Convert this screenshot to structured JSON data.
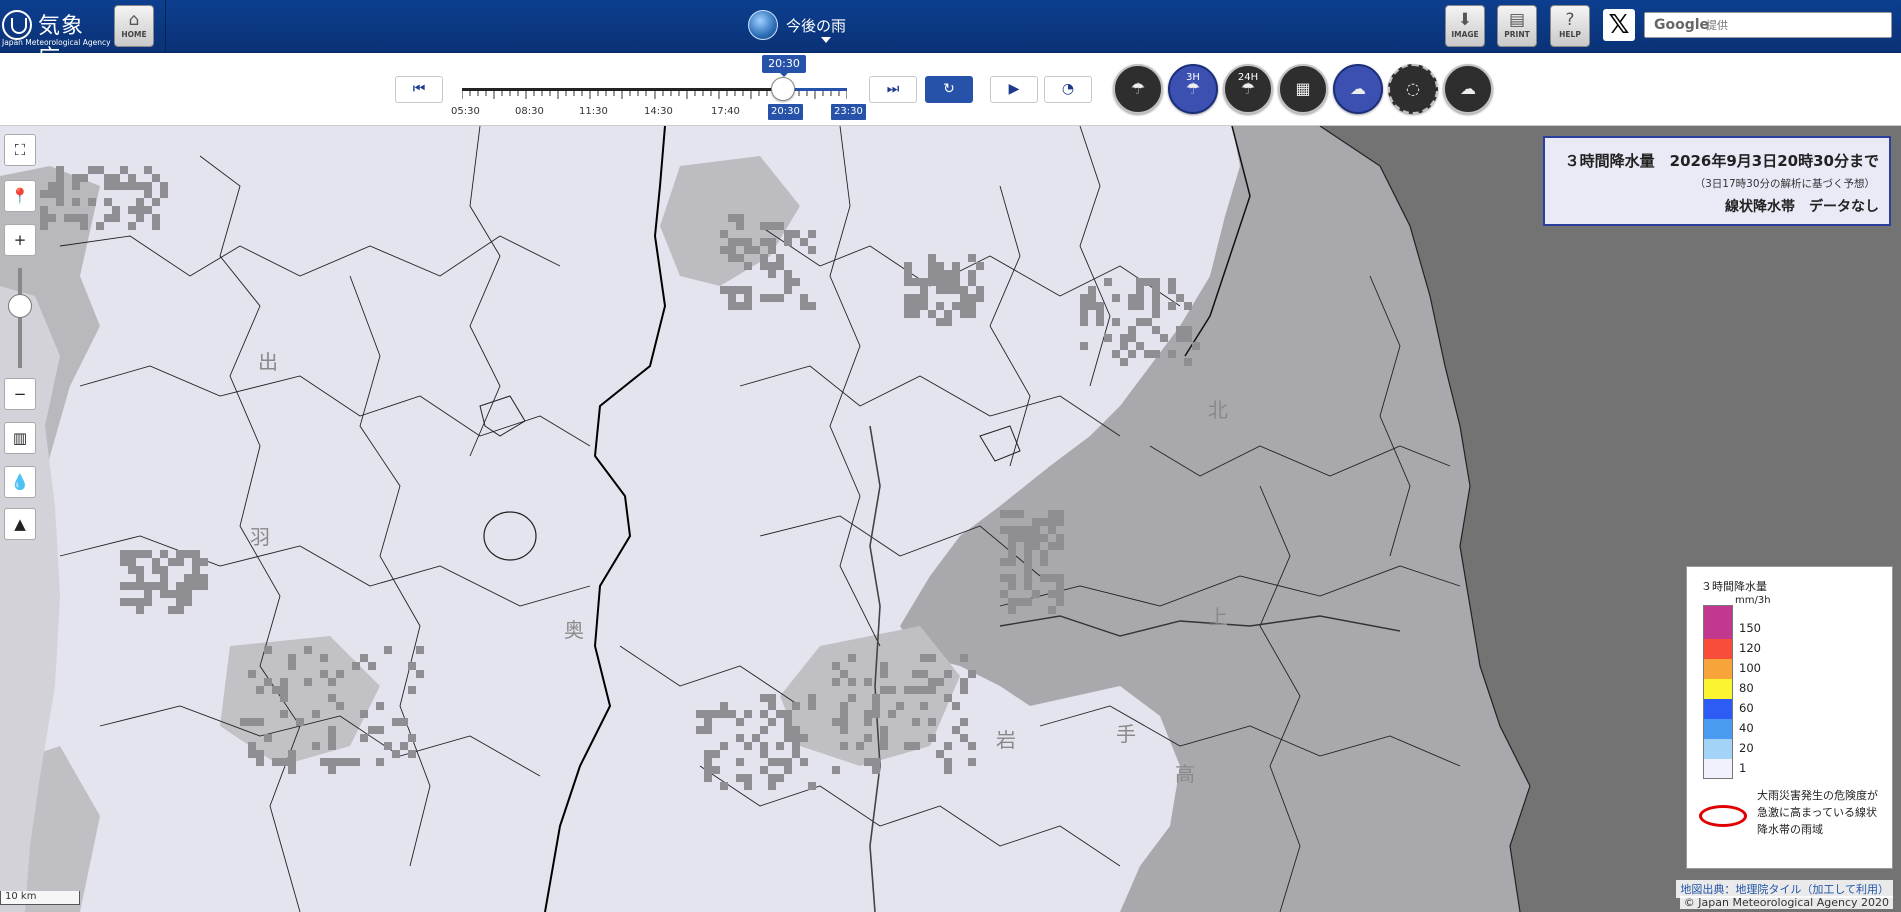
{
  "header": {
    "agency_jp": "気象庁",
    "agency_en": "Japan Meteorological Agency",
    "home_label": "HOME",
    "page_title": "今後の雨",
    "image_label": "IMAGE",
    "print_label": "PRINT",
    "help_label": "HELP",
    "search_brand": "Google",
    "search_placeholder": "提供"
  },
  "timeline": {
    "current_time": "20:30",
    "tick_labels": [
      "05:30",
      "08:30",
      "11:30",
      "14:30",
      "17:40"
    ],
    "selected_label": "20:30",
    "end_label": "23:30"
  },
  "layers": [
    {
      "name": "rain-now-layer",
      "label": "",
      "active": false
    },
    {
      "name": "rain-3h-layer",
      "label": "3H",
      "active": true
    },
    {
      "name": "rain-24h-layer",
      "label": "24H",
      "active": false
    },
    {
      "name": "grid-layer",
      "label": "",
      "active": false
    },
    {
      "name": "linear-rainband-layer",
      "label": "",
      "active": true
    },
    {
      "name": "dashed-outline-layer",
      "label": "",
      "active": false
    },
    {
      "name": "wind-layer",
      "label": "",
      "active": false
    }
  ],
  "info_box": {
    "line1": "３時間降水量　2026年9月3日20時30分まで",
    "line2": "（3日17時30分の解析に基づく予想）",
    "line3": "線状降水帯　データなし"
  },
  "legend": {
    "title": "３時間降水量",
    "unit": "mm/3h",
    "levels": [
      {
        "value": "150",
        "color": "#c2388e"
      },
      {
        "value": "120",
        "color": "#f94d3c"
      },
      {
        "value": "100",
        "color": "#f7a43a"
      },
      {
        "value": "80",
        "color": "#fbf431"
      },
      {
        "value": "60",
        "color": "#2c5cf3"
      },
      {
        "value": "40",
        "color": "#4a9cf2"
      },
      {
        "value": "20",
        "color": "#a4d3f8"
      },
      {
        "value": "1",
        "color": "#f1f1fd"
      }
    ],
    "top_color": "#c2388e",
    "rainband_description": "大雨災害発生の危険度が急激に高まっている線状降水帯の雨域"
  },
  "map": {
    "labels": [
      "出",
      "羽",
      "奥",
      "北",
      "上",
      "高",
      "手",
      "岩"
    ],
    "scale_text": "10 km",
    "attribution_source": "地図出典：地理院タイル（加工して利用）",
    "copyright": "© Japan Meteorological Agency 2020"
  }
}
